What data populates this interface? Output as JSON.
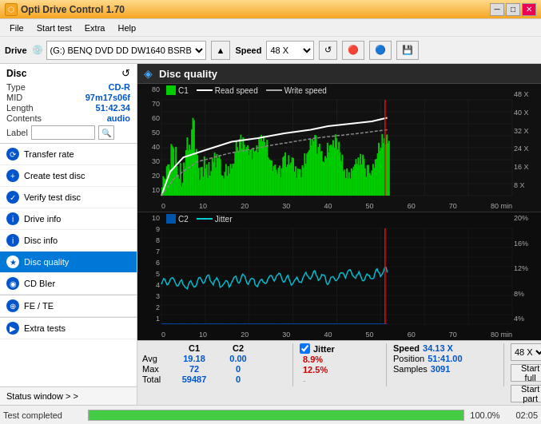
{
  "titleBar": {
    "title": "Opti Drive Control 1.70",
    "icon": "⬡",
    "minimize": "─",
    "maximize": "□",
    "close": "✕"
  },
  "menuBar": {
    "items": [
      "File",
      "Start test",
      "Extra",
      "Help"
    ]
  },
  "toolbar": {
    "driveLabel": "Drive",
    "driveValue": "(G:)  BENQ DVD DD DW1640 BSRB",
    "speedLabel": "Speed",
    "speedValue": "48 X"
  },
  "disc": {
    "title": "Disc",
    "type": {
      "label": "Type",
      "value": "CD-R"
    },
    "mid": {
      "label": "MID",
      "value": "97m17s06f"
    },
    "length": {
      "label": "Length",
      "value": "51:42.34"
    },
    "contents": {
      "label": "Contents",
      "value": "audio"
    },
    "labelField": {
      "label": "Label",
      "placeholder": ""
    }
  },
  "nav": {
    "items": [
      {
        "id": "transfer-rate",
        "label": "Transfer rate",
        "active": false
      },
      {
        "id": "create-test-disc",
        "label": "Create test disc",
        "active": false
      },
      {
        "id": "verify-test-disc",
        "label": "Verify test disc",
        "active": false
      },
      {
        "id": "drive-info",
        "label": "Drive info",
        "active": false
      },
      {
        "id": "disc-info",
        "label": "Disc info",
        "active": false
      },
      {
        "id": "disc-quality",
        "label": "Disc quality",
        "active": true
      },
      {
        "id": "cd-bier",
        "label": "CD BIer",
        "active": false
      }
    ],
    "feTeLabel": "FE / TE",
    "extraTests": "Extra tests",
    "statusWindow": "Status window > >"
  },
  "chart": {
    "title": "Disc quality",
    "legend": {
      "c1Label": "C1",
      "readSpeedLabel": "Read speed",
      "writeSpeedLabel": "Write speed",
      "c2Label": "C2",
      "jitterLabel": "Jitter"
    },
    "topAxis": {
      "yLeft": [
        "80",
        "70",
        "60",
        "50",
        "40",
        "30",
        "20",
        "10"
      ],
      "yRight": [
        "48 X",
        "40 X",
        "32 X",
        "24 X",
        "16 X",
        "8 X"
      ],
      "xLabels": [
        "0",
        "10",
        "20",
        "30",
        "40",
        "50",
        "60",
        "70",
        "80 min"
      ]
    },
    "bottomAxis": {
      "yLeft": [
        "10",
        "9",
        "8",
        "7",
        "6",
        "5",
        "4",
        "3",
        "2",
        "1"
      ],
      "yRight": [
        "20%",
        "16%",
        "12%",
        "8%",
        "4%"
      ],
      "xLabels": [
        "0",
        "10",
        "20",
        "30",
        "40",
        "50",
        "60",
        "70",
        "80 min"
      ]
    },
    "redLinePos": 51
  },
  "stats": {
    "headers": [
      "C1",
      "C2",
      "",
      "Jitter",
      "Speed",
      ""
    ],
    "avg": {
      "c1": "19.18",
      "c2": "0.00",
      "jitter": "8.9%",
      "speed": "34.13 X"
    },
    "max": {
      "c1": "72",
      "c2": "0",
      "jitter": "12.5%",
      "position": "51:41.00"
    },
    "total": {
      "c1": "59487",
      "c2": "0",
      "samples": "3091"
    },
    "rowLabels": [
      "Avg",
      "Max",
      "Total"
    ],
    "labels2": [
      "Speed",
      "Position",
      "Samples"
    ],
    "speedSelect": "48 X",
    "startFull": "Start full",
    "startPart": "Start part"
  },
  "statusBar": {
    "text": "Test completed",
    "progress": 100,
    "progressText": "100.0%",
    "time": "02:05"
  },
  "colors": {
    "accent": "#0078d7",
    "c1Bar": "#00cc00",
    "readSpeed": "#ffffff",
    "c2Bar": "#00aaff",
    "jitter": "#00cccc",
    "redLine": "#ff0000"
  }
}
